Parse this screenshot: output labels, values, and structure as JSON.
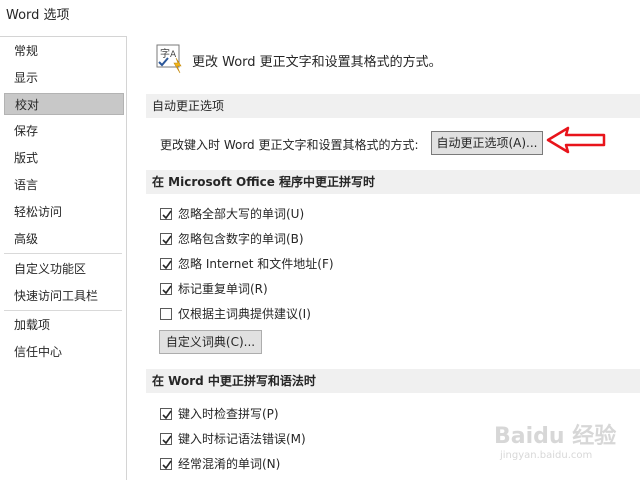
{
  "window": {
    "title": "Word 选项"
  },
  "sidebar": {
    "items": [
      {
        "label": "常规",
        "selected": false
      },
      {
        "label": "显示",
        "selected": false
      },
      {
        "label": "校对",
        "selected": true
      },
      {
        "label": "保存",
        "selected": false
      },
      {
        "label": "版式",
        "selected": false
      },
      {
        "label": "语言",
        "selected": false
      },
      {
        "label": "轻松访问",
        "selected": false
      },
      {
        "label": "高级",
        "selected": false
      },
      {
        "label": "自定义功能区",
        "selected": false
      },
      {
        "label": "快速访问工具栏",
        "selected": false
      },
      {
        "label": "加载项",
        "selected": false
      },
      {
        "label": "信任中心",
        "selected": false
      }
    ]
  },
  "main": {
    "header_text": "更改 Word 更正文字和设置其格式的方式。",
    "autocorrect_section": {
      "title": "自动更正选项",
      "description": "更改键入时 Word 更正文字和设置其格式的方式:",
      "button_label": "自动更正选项(A)..."
    },
    "office_section": {
      "title": "在 Microsoft Office 程序中更正拼写时",
      "options": [
        {
          "label": "忽略全部大写的单词(U)",
          "checked": true
        },
        {
          "label": "忽略包含数字的单词(B)",
          "checked": true
        },
        {
          "label": "忽略 Internet 和文件地址(F)",
          "checked": true
        },
        {
          "label": "标记重复单词(R)",
          "checked": true
        },
        {
          "label": "仅根据主词典提供建议(I)",
          "checked": false
        }
      ],
      "custom_dict_button": "自定义词典(C)..."
    },
    "word_section": {
      "title": "在 Word 中更正拼写和语法时",
      "options": [
        {
          "label": "键入时检查拼写(P)",
          "checked": true
        },
        {
          "label": "键入时标记语法错误(M)",
          "checked": true
        },
        {
          "label": "经常混淆的单词(N)",
          "checked": true
        }
      ]
    }
  },
  "annotation": {
    "arrow_color": "#e8141b"
  },
  "watermark": {
    "main": "Baidu 经验",
    "sub": "jingyan.baidu.com"
  }
}
